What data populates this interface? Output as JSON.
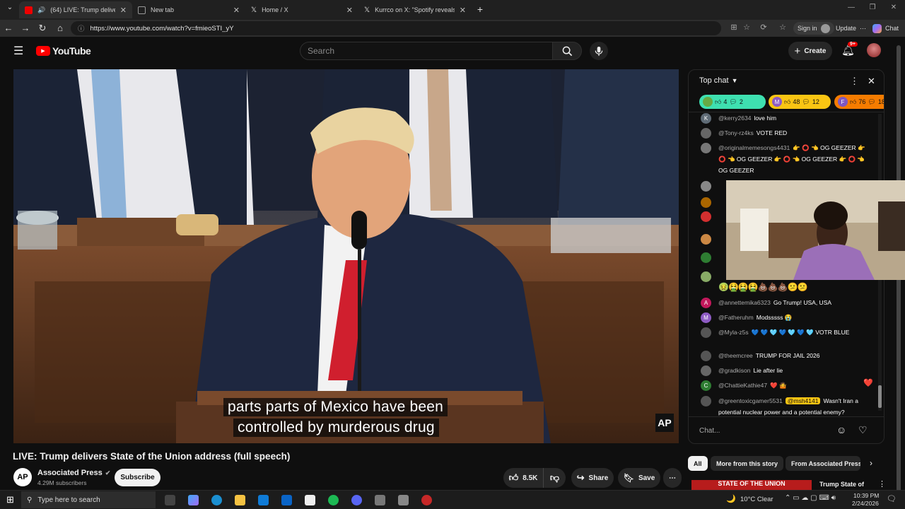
{
  "browser": {
    "tabs": [
      {
        "title": "(64) LIVE: Trump delivers State",
        "icon": "youtube-icon"
      },
      {
        "title": "New tab",
        "icon": "newtab-icon"
      },
      {
        "title": "Home / X",
        "icon": "x-icon"
      },
      {
        "title": "Kurrco on X: \"Spotify reveals its la",
        "icon": "x-icon"
      }
    ],
    "url": "https://www.youtube.com/watch?v=fmieoSTI_yY",
    "sign_in": "Sign in",
    "update": "Update",
    "chat": "Chat"
  },
  "youtube": {
    "logo": "YouTube",
    "search_placeholder": "Search",
    "create": "Create",
    "notifications": "9+"
  },
  "video": {
    "caption_line1": "parts parts of Mexico have been",
    "caption_line2": "controlled by murderous drug",
    "watermark": "AP",
    "title": "LIVE: Trump delivers State of the Union address (full speech)",
    "channel": "Associated Press",
    "subscribers": "4.29M subscribers",
    "channel_initials": "AP",
    "subscribe": "Subscribe",
    "likes": "8.5K",
    "share": "Share",
    "save": "Save"
  },
  "chat": {
    "header": "Top chat",
    "badges": [
      {
        "count1": "4",
        "count2": "2",
        "color": "#3ee0b0"
      },
      {
        "letter": "M",
        "count1": "48",
        "count2": "12",
        "color": "#f9c513"
      },
      {
        "letter": "F",
        "count1": "76",
        "count2": "18",
        "color": "#f57c00"
      }
    ],
    "messages": [
      {
        "initial": "K",
        "color": "#5f6b76",
        "author": "@kerry2634",
        "text": "love him"
      },
      {
        "initial": "",
        "color": "#666",
        "author": "@Tony-rz4ks",
        "text": "VOTE RED"
      },
      {
        "initial": "",
        "color": "#777",
        "author": "@originalmemesongs4431",
        "text": "👉 ⭕ 👈 OG GEEZER 👉 ⭕ 👈 OG GEEZER 👉 ⭕ 👈 OG GEEZER 👉 ⭕ 👈 OG GEEZER"
      },
      {
        "initial": "A",
        "color": "#c2185b",
        "author": "@annettemika6323",
        "text": "Go Trump! USA, USA"
      },
      {
        "initial": "M",
        "color": "#8e5cc4",
        "author": "@Fatheruhm",
        "text": "Modsssss 😭"
      },
      {
        "initial": "",
        "color": "#555",
        "author": "@Myla-z5s",
        "text": "💙 💙 🩵 💙 🩵 💙 🩵 VOTR BLUE"
      },
      {
        "initial": "",
        "color": "#555",
        "author": "@theemcree",
        "text": "TRUMP FOR JAIL 2026"
      },
      {
        "initial": "",
        "color": "#666",
        "author": "@gradkison",
        "text": "Lie after lie"
      },
      {
        "initial": "C",
        "color": "#2e7d32",
        "author": "@ChattieKathie47",
        "text": "❤️ 🤷"
      },
      {
        "initial": "",
        "color": "#555",
        "author": "@greentoxicgamer5531",
        "mention": "@msh4141",
        "text": "Wasn't Iran a potential nuclear power and a potential enemy?"
      }
    ],
    "emoji_row": "🤢🤮🤮🤮💩💩💩😕😕",
    "input_placeholder": "Chat..."
  },
  "below_chat": {
    "chips": [
      "All",
      "More from this story",
      "From Associated Press"
    ],
    "up_next_banner": "STATE OF THE UNION",
    "up_next_title": "Trump State of"
  },
  "taskbar": {
    "search_placeholder": "Type here to search",
    "weather": "10°C  Clear",
    "time": "10:39 PM",
    "date": "2/24/2026"
  }
}
